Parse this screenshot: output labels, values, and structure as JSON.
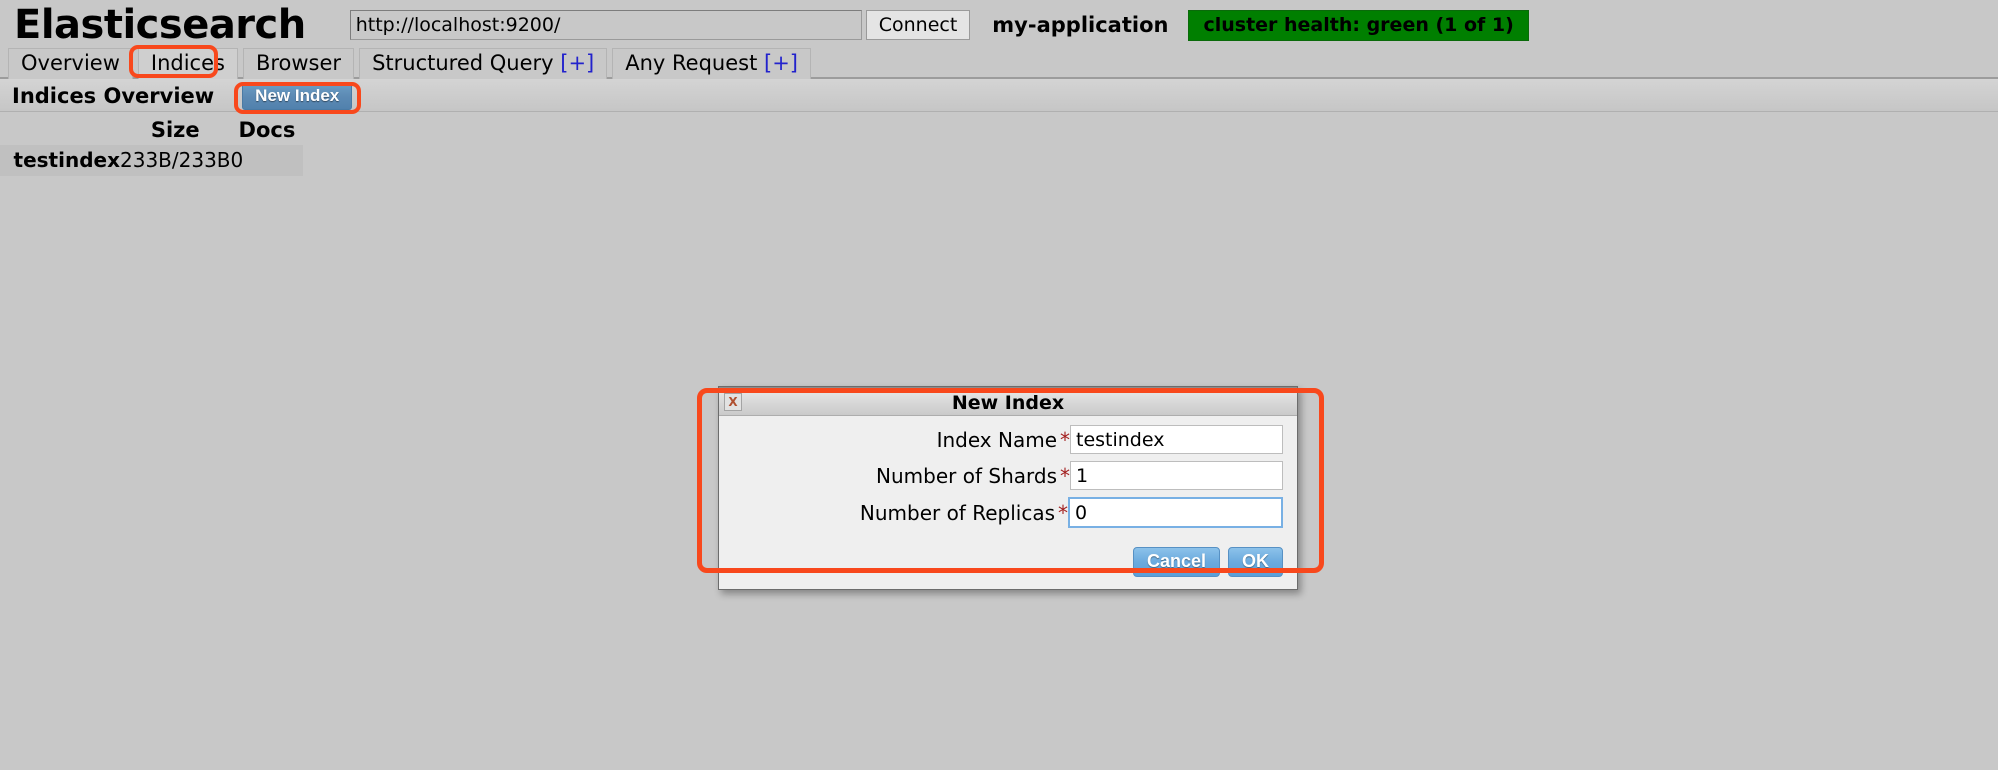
{
  "header": {
    "brand": "Elasticsearch",
    "url_value": "http://localhost:9200/",
    "url_placeholder": "http://localhost:9200/",
    "connect_label": "Connect",
    "app_name": "my-application",
    "cluster_health": "cluster health: green (1 of 1)",
    "health_color": "#007f00"
  },
  "tabs": [
    {
      "label": "Overview",
      "plus": "",
      "active": false
    },
    {
      "label": "Indices",
      "plus": "",
      "active": true
    },
    {
      "label": "Browser",
      "plus": "",
      "active": false
    },
    {
      "label": "Structured Query ",
      "plus": "[+]",
      "active": false
    },
    {
      "label": "Any Request ",
      "plus": "[+]",
      "active": false
    }
  ],
  "content": {
    "section_title": "Indices Overview",
    "new_index_label": "New Index"
  },
  "table": {
    "columns": [
      "",
      "Size",
      "Docs"
    ],
    "rows": [
      {
        "name": "testindex",
        "size": "233B/233B",
        "docs": "0"
      }
    ]
  },
  "dialog": {
    "title": "New Index",
    "close_icon": "X",
    "fields": [
      {
        "label": "Index Name",
        "required": "*",
        "value": "testindex",
        "focused": false
      },
      {
        "label": "Number of Shards",
        "required": "*",
        "value": "1",
        "focused": false
      },
      {
        "label": "Number of Replicas",
        "required": "*",
        "value": "0",
        "focused": true
      }
    ],
    "cancel_label": "Cancel",
    "ok_label": "OK"
  },
  "annotations": {
    "ring_color": "#f8481c"
  }
}
